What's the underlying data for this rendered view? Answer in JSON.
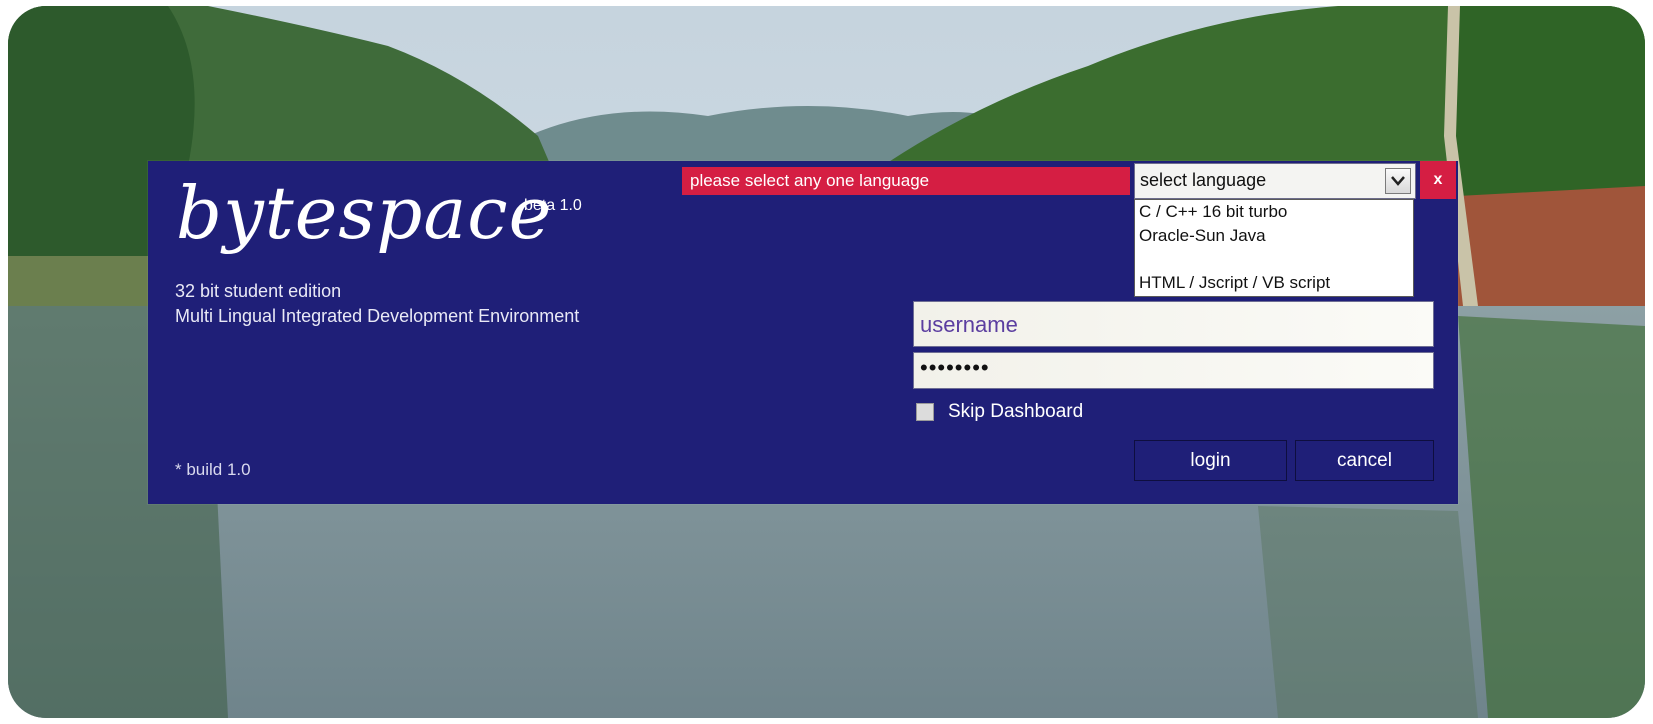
{
  "app": {
    "logo_text": "bytespace",
    "version_badge": "beta 1.0",
    "edition": "32 bit student edition",
    "subtitle": "Multi Lingual Integrated Development Environment",
    "build": "* build 1.0"
  },
  "language_picker": {
    "warning": "please select any one language",
    "selected": "select language",
    "options": [
      "C / C++ 16 bit turbo",
      "Oracle-Sun Java",
      "",
      "HTML / Jscript / VB script"
    ]
  },
  "login_form": {
    "username_value": "username",
    "password_value": "••••••••",
    "skip_dashboard_label": "Skip Dashboard",
    "skip_dashboard_checked": false,
    "login_label": "login",
    "cancel_label": "cancel"
  },
  "window": {
    "close_label": "x"
  },
  "colors": {
    "panel": "#1f1f78",
    "accent_red": "#d51e43"
  }
}
